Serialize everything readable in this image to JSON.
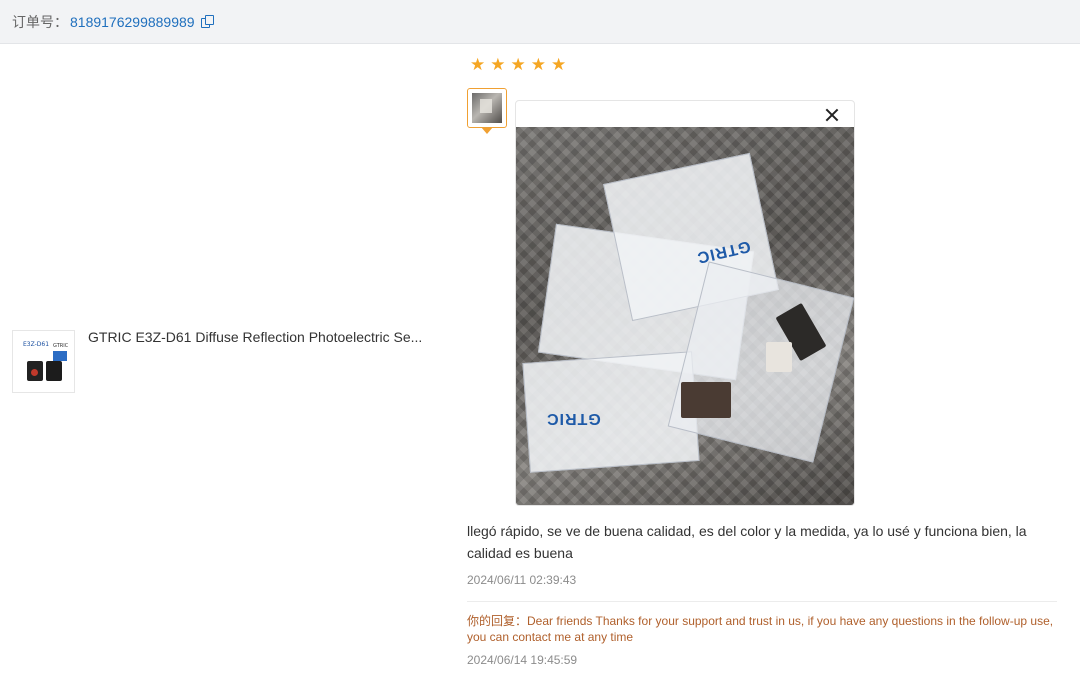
{
  "order": {
    "label": "订单号：",
    "number": "8189176299889989",
    "copy_icon": "copy-icon"
  },
  "product": {
    "title": "GTRIC E3Z-D61 Diffuse Reflection Photoelectric Se..."
  },
  "rating": {
    "stars": 5,
    "max": 5,
    "color": "#f5a623"
  },
  "review": {
    "text": "llegó rápido, se ve de buena calidad, es del color y la medida, ya lo usé y funciona bien, la calidad es buena",
    "time": "2024/06/11 02:39:43",
    "reply_label": "你的回复：",
    "reply_text": "Dear friends Thanks for your support and trust in us, if you have any questions in the follow-up use, you can contact me at any time",
    "reply_time": "2024/06/14 19:45:59"
  },
  "photo_brand": "GTRIC",
  "colors": {
    "link": "#1f6fbd",
    "reply": "#b0602c",
    "thumb_border": "#f0a032"
  }
}
